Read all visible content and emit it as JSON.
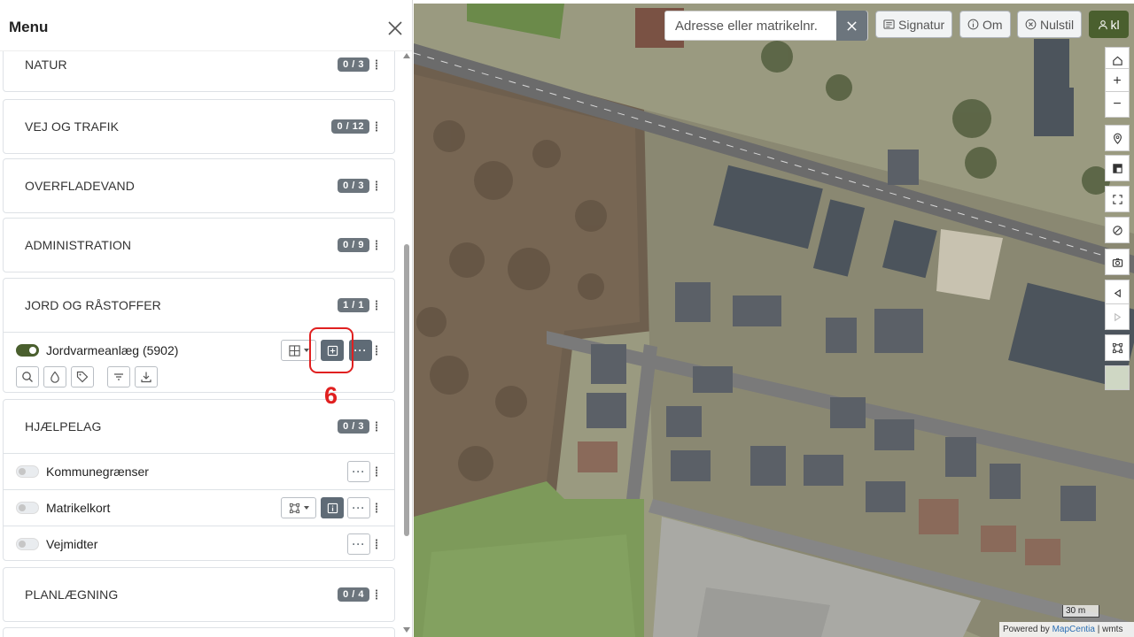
{
  "sidebar": {
    "title": "Menu",
    "sections": [
      {
        "title": "NATUR",
        "badge": "0 / 3"
      },
      {
        "title": "VEJ OG TRAFIK",
        "badge": "0 / 12"
      },
      {
        "title": "OVERFLADEVAND",
        "badge": "0 / 3"
      },
      {
        "title": "ADMINISTRATION",
        "badge": "0 / 9"
      },
      {
        "title": "JORD OG RÅSTOFFER",
        "badge": "1 / 1"
      },
      {
        "title": "HJÆLPELAG",
        "badge": "0 / 3"
      },
      {
        "title": "PLANLÆGNING",
        "badge": "0 / 4"
      }
    ],
    "jord_layers": [
      {
        "name": "Jordvarmeanlæg (5902)",
        "enabled": true
      }
    ],
    "hjaelpelag_layers": [
      {
        "name": "Kommunegrænser",
        "enabled": false
      },
      {
        "name": "Matrikelkort",
        "enabled": false
      },
      {
        "name": "Vejmidter",
        "enabled": false
      }
    ],
    "more_label": "···"
  },
  "annotation": {
    "number": "6",
    "color": "#e02020"
  },
  "map": {
    "search_placeholder": "Adresse eller matrikelnr.",
    "buttons": {
      "signatur": "Signatur",
      "om": "Om",
      "nulstil": "Nulstil",
      "user": "kl"
    },
    "zoom_in": "+",
    "zoom_out": "−",
    "scale": "30 m",
    "attribution_prefix": "Powered by ",
    "attribution_brand": "MapCentia",
    "attribution_suffix": " | wmts"
  },
  "colors": {
    "accent": "#4a5f2e",
    "badge": "#6c757d",
    "highlight": "#e02020"
  }
}
